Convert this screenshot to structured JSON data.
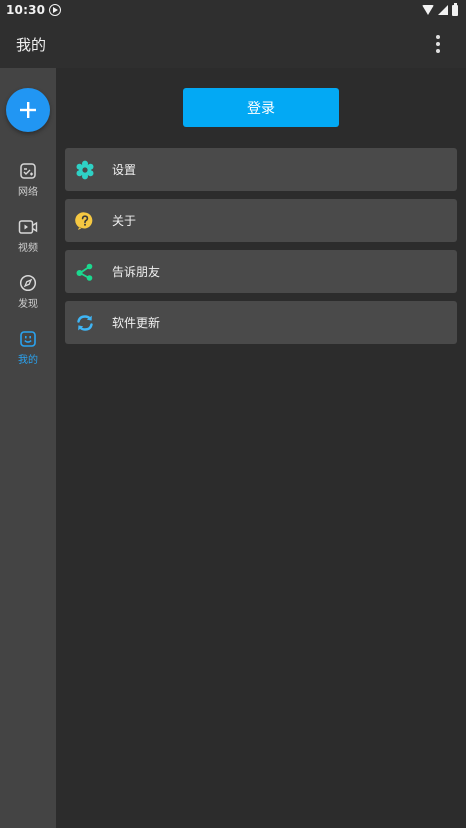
{
  "status_bar": {
    "time": "10:30"
  },
  "app_bar": {
    "title": "我的"
  },
  "sidebar": {
    "items": [
      {
        "label": "网络",
        "icon": "network-icon"
      },
      {
        "label": "视频",
        "icon": "video-icon"
      },
      {
        "label": "发现",
        "icon": "compass-icon"
      },
      {
        "label": "我的",
        "icon": "smile-icon",
        "active": true
      }
    ]
  },
  "main": {
    "login_label": "登录",
    "menu": [
      {
        "label": "设置",
        "icon": "gear-icon",
        "color": "#2fd1c5"
      },
      {
        "label": "关于",
        "icon": "help-icon",
        "color": "#f5c842"
      },
      {
        "label": "告诉朋友",
        "icon": "share-icon",
        "color": "#1bd98f"
      },
      {
        "label": "软件更新",
        "icon": "refresh-icon",
        "color": "#3fb5f5"
      }
    ]
  },
  "colors": {
    "accent": "#03a9f4",
    "fab": "#2196f3",
    "active_nav": "#2aa3f0"
  }
}
